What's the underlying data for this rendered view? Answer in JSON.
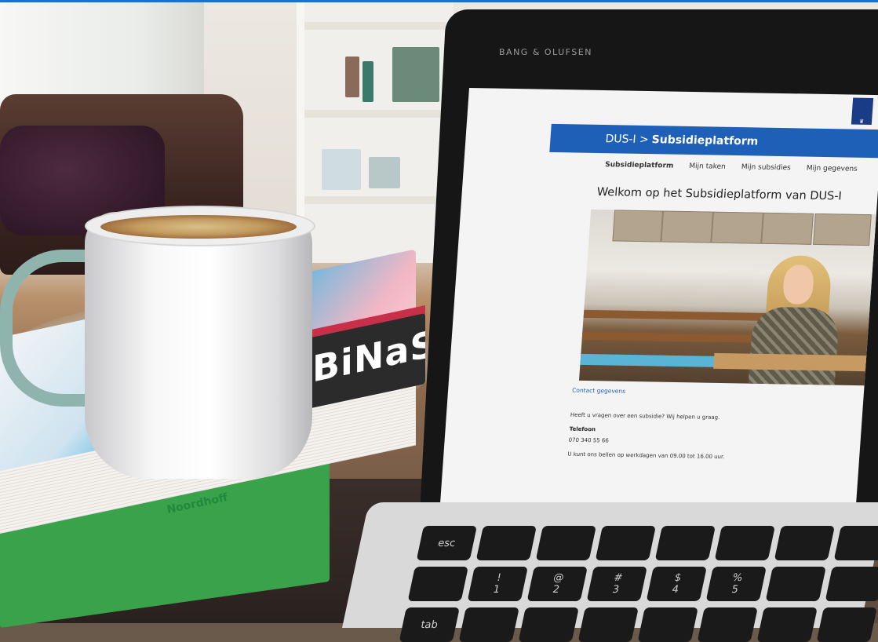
{
  "laptop": {
    "brand": "BANG & OLUFSEN"
  },
  "book": {
    "title": "BiNaS",
    "publisher_logo": "Noordhoff"
  },
  "webpage": {
    "breadcrumb_prefix": "DUS-I >",
    "breadcrumb_current": "Subsidieplatform",
    "nav": [
      {
        "label": "Subsidieplatform",
        "active": true
      },
      {
        "label": "Mijn taken",
        "active": false
      },
      {
        "label": "Mijn subsidies",
        "active": false
      },
      {
        "label": "Mijn gegevens",
        "active": false
      }
    ],
    "welcome_title": "Welkom op het Subsidieplatform van DUS-I",
    "contact_heading": "Contact gegevens",
    "contact_intro": "Heeft u vragen over een subsidie? Wij helpen u graag.",
    "phone_label": "Telefoon",
    "phone_number": "070 340 55 66",
    "hours_note": "U kunt ons bellen op werkdagen van 09.00 tot 16.00 uur.",
    "logo_icon": "rijksoverheid-logo-icon"
  },
  "keyboard": {
    "keys": [
      "esc",
      "",
      "",
      "",
      "",
      "",
      "",
      "",
      "",
      "!\n1",
      "@\n2",
      "#\n3",
      "$\n4",
      "%\n5",
      "",
      "",
      "tab",
      "",
      "",
      "",
      "",
      "",
      "",
      ""
    ]
  },
  "colors": {
    "header_blue": "#1e5fb8",
    "binas_red": "#c8304a",
    "mug_handle": "#8fb3ad"
  }
}
